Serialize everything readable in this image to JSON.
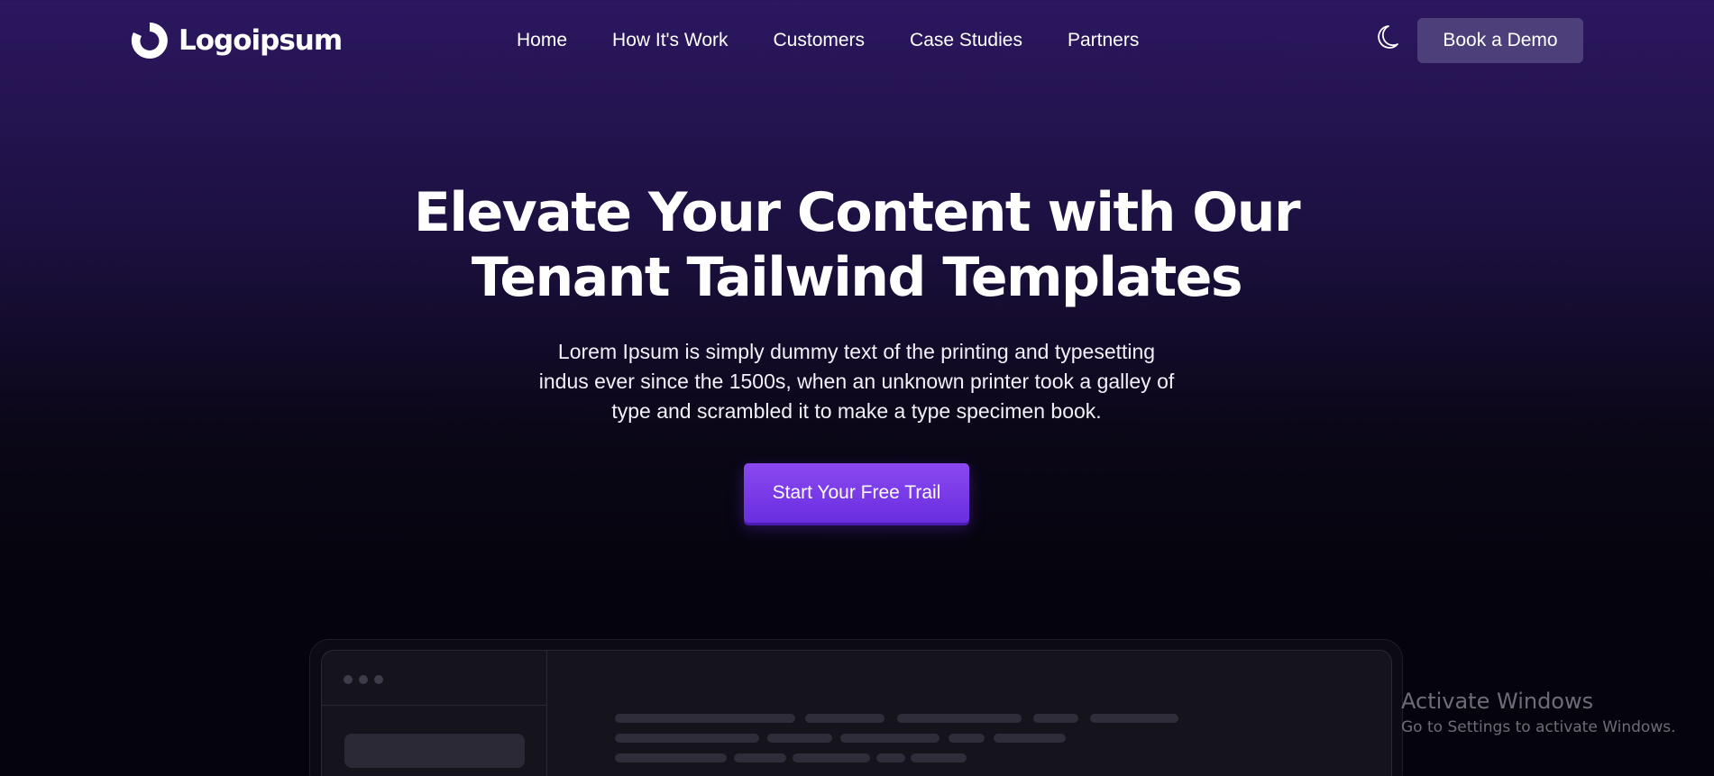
{
  "header": {
    "logo_text": "Logoipsum",
    "nav": [
      {
        "label": "Home"
      },
      {
        "label": "How It's Work"
      },
      {
        "label": "Customers"
      },
      {
        "label": "Case Studies"
      },
      {
        "label": "Partners"
      }
    ],
    "theme_icon": "moon-icon",
    "demo_button": "Book a Demo"
  },
  "hero": {
    "title_line1": "Elevate Your Content with Our",
    "title_line2": "Tenant Tailwind Templates",
    "description_line1": "Lorem Ipsum is simply dummy text of the printing and typesetting",
    "description_line2": "indus ever since the 1500s, when an unknown printer took a galley of",
    "description_line3": "type and scrambled it to make a type specimen book.",
    "cta": "Start Your Free Trail"
  },
  "watermark": {
    "title": "Activate Windows",
    "subtitle": "Go to Settings to activate Windows."
  },
  "colors": {
    "background_top": "#2c1760",
    "background_bottom": "#05040c",
    "cta": "#7b3ff0",
    "demo_button": "#4c3f7a"
  }
}
